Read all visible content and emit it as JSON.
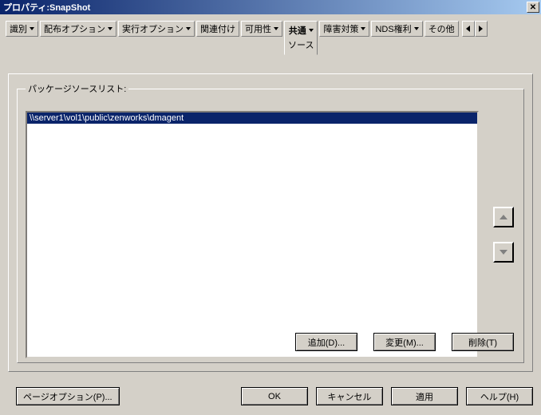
{
  "title": "プロパティ:SnapShot",
  "tabs": [
    {
      "label": "識別"
    },
    {
      "label": "配布オプション"
    },
    {
      "label": "実行オプション"
    },
    {
      "label": "関連付け"
    },
    {
      "label": "可用性"
    },
    {
      "label": "共通",
      "subtext": "ソース"
    },
    {
      "label": "障害対策"
    },
    {
      "label": "NDS権利"
    },
    {
      "label": "その他"
    }
  ],
  "groupbox_label": "パッケージソースリスト:",
  "list_items": [
    "\\\\server1\\vol1\\public\\zenworks\\dmagent"
  ],
  "buttons": {
    "add": "追加(D)...",
    "change": "変更(M)...",
    "delete": "削除(T)"
  },
  "bottom": {
    "page_options": "ページオプション(P)...",
    "ok": "OK",
    "cancel": "キャンセル",
    "apply": "適用",
    "help": "ヘルプ(H)"
  }
}
